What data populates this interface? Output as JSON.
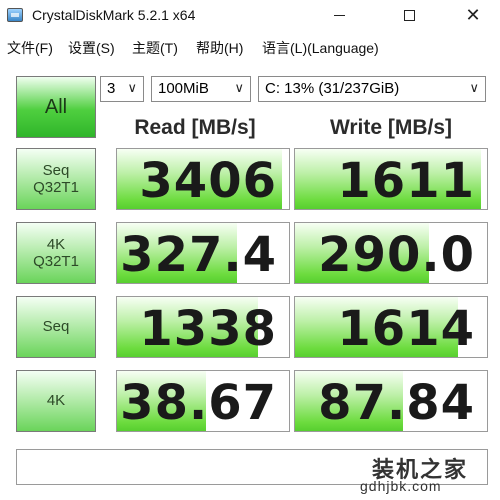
{
  "window": {
    "title": "CrystalDiskMark 5.2.1 x64",
    "icons": [
      "app-icon",
      "minimize-icon",
      "maximize-icon",
      "close-icon"
    ],
    "close_glyph": "✕"
  },
  "menu": {
    "items": [
      "文件(F)",
      "设置(S)",
      "主题(T)",
      "帮助(H)",
      "语言(L)(Language)"
    ]
  },
  "controls": {
    "all_label": "All",
    "test_count": "3",
    "test_size": "100MiB",
    "drive": "C: 13% (31/237GiB)",
    "dropdown_glyph": "∨"
  },
  "headers": {
    "read": "Read [MB/s]",
    "write": "Write [MB/s]"
  },
  "rows": [
    {
      "label_line1": "Seq",
      "label_line2": "Q32T1",
      "read": "3406",
      "write": "1611",
      "read_fill": 0.96,
      "write_fill": 0.97
    },
    {
      "label_line1": "4K",
      "label_line2": "Q32T1",
      "read": "327.4",
      "write": "290.0",
      "read_fill": 0.7,
      "write_fill": 0.7
    },
    {
      "label_line1": "Seq",
      "label_line2": "",
      "read": "1338",
      "write": "1614",
      "read_fill": 0.82,
      "write_fill": 0.85
    },
    {
      "label_line1": "4K",
      "label_line2": "",
      "read": "38.67",
      "write": "87.84",
      "read_fill": 0.52,
      "write_fill": 0.56
    }
  ],
  "status_text": "",
  "watermark": {
    "text": "装机之家",
    "url": "gdhjbk.com"
  },
  "colors": {
    "accent_green": "#57cf2f",
    "light_green": "#bdf0a8"
  }
}
